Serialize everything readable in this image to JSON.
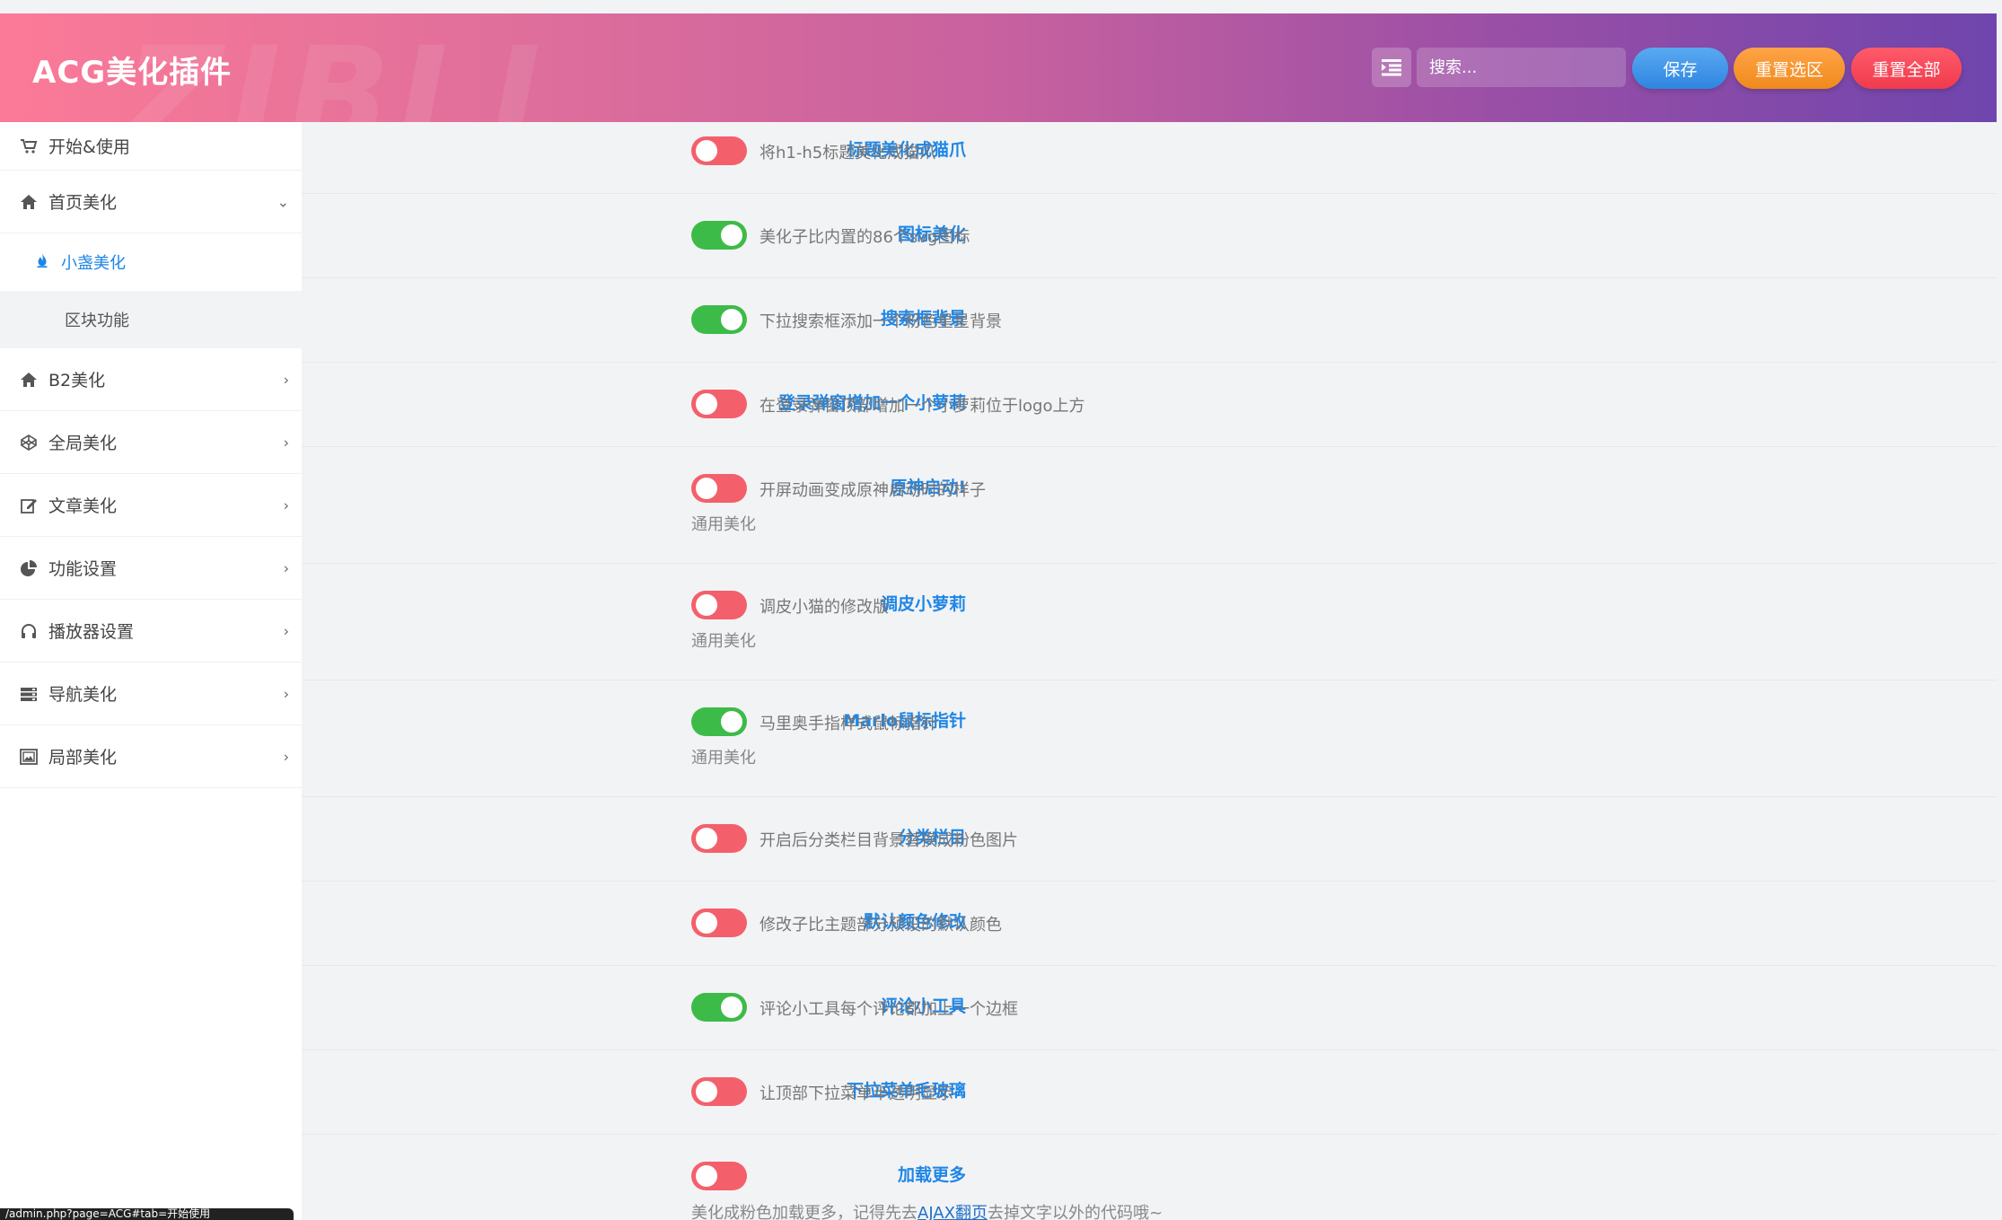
{
  "header": {
    "brand": "ACG美化插件",
    "watermark": "ZIBLL",
    "search_placeholder": "搜索...",
    "save_label": "保存",
    "reset_section_label": "重置选区",
    "reset_all_label": "重置全部",
    "colors": {
      "gradient_start": "#fb7a97",
      "gradient_end": "#6f45ad",
      "save": "#3d93e8",
      "reset_section": "#f5941f",
      "reset_all": "#f5434f"
    }
  },
  "sidebar": {
    "items": [
      {
        "label": "开始&使用",
        "icon": "cart-icon"
      },
      {
        "label": "首页美化",
        "icon": "home-icon",
        "expanded": true
      },
      {
        "label": "B2美化",
        "icon": "home-icon"
      },
      {
        "label": "全局美化",
        "icon": "codepen-icon"
      },
      {
        "label": "文章美化",
        "icon": "edit-icon"
      },
      {
        "label": "功能设置",
        "icon": "pie-chart-icon"
      },
      {
        "label": "播放器设置",
        "icon": "headphones-icon"
      },
      {
        "label": "导航美化",
        "icon": "server-icon"
      },
      {
        "label": "局部美化",
        "icon": "image-frame-icon"
      }
    ],
    "sub_items": [
      {
        "label": "小盏美化",
        "icon": "fire-icon",
        "active": true
      },
      {
        "label": "区块功能",
        "active": false
      }
    ]
  },
  "status_bar": {
    "text": "/admin.php?page=ACG#tab=开始使用"
  },
  "settings": [
    {
      "label": "标题美化成猫爪",
      "on": false,
      "desc": "将h1-h5标题美化成猫爪"
    },
    {
      "label": "图标美化",
      "on": true,
      "desc": "美化子比内置的86个svg图标"
    },
    {
      "label": "搜索框背景",
      "on": true,
      "desc": "下拉搜索框添加一个粉色星星背景"
    },
    {
      "label": "登录弹窗增加一个小萝莉",
      "on": false,
      "desc": "在登录弹窗顶部增加一个小萝莉位于logo上方"
    },
    {
      "label": "原神启动!",
      "on": false,
      "desc": "开屏动画变成原神启动时的样子",
      "sub": "通用美化"
    },
    {
      "label": "调皮小萝莉",
      "on": false,
      "desc": "调皮小猫的修改版",
      "sub": "通用美化"
    },
    {
      "label": "Mario鼠标指针",
      "on": true,
      "desc": "马里奥手指样式鼠标指针",
      "sub": "通用美化"
    },
    {
      "label": "分类栏目",
      "on": false,
      "desc": "开启后分类栏目背景替换成粉色图片"
    },
    {
      "label": "默认颜色修改",
      "on": false,
      "desc": "修改子比主题部分预设的默认颜色"
    },
    {
      "label": "评论小工具",
      "on": true,
      "desc": "评论小工具每个评论都加上一个边框"
    },
    {
      "label": "下拉菜单毛玻璃",
      "on": false,
      "desc": "让顶部下拉菜单半透明显示"
    },
    {
      "label": "加载更多",
      "on": false,
      "sub_before": "美化成粉色加载更多，记得先去",
      "sub_link": "AJAX翻页",
      "sub_after": "去掉文字以外的代码哦~"
    }
  ]
}
